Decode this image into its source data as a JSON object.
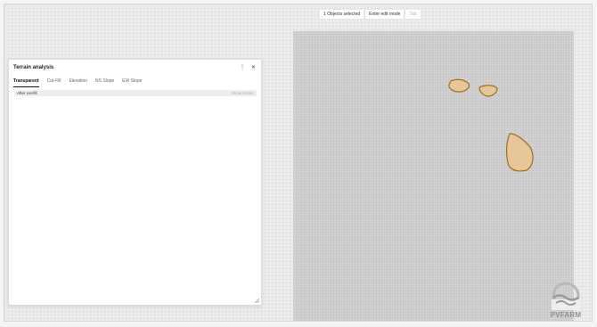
{
  "toolbar": {
    "selected_label": "1 Objects selected",
    "edit_label": "Enter edit mode",
    "tab_hint": "Tab"
  },
  "panel": {
    "title": "Terrain analysis",
    "menu_icon": "more-vertical-icon",
    "close_icon": "close-icon",
    "tabs": [
      {
        "label": "Transparent",
        "active": true
      },
      {
        "label": "Cut-Fill",
        "active": false
      },
      {
        "label": "Elevation",
        "active": false
      },
      {
        "label": "NS Slope",
        "active": false
      },
      {
        "label": "EW Slope",
        "active": false
      }
    ],
    "row": {
      "label": "After cut-fill",
      "action": "Show terrain"
    }
  },
  "branding": {
    "logo_text": "PVFARM"
  },
  "colors": {
    "shape_fill": "#e8c69b",
    "shape_stroke": "#a06d1a"
  }
}
